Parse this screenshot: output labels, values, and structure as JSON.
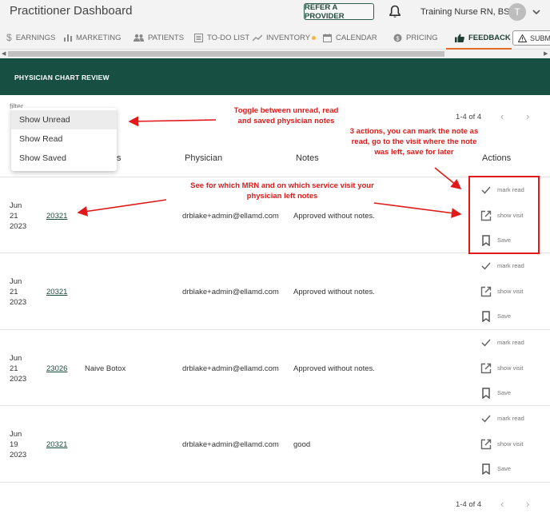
{
  "header": {
    "title": "Practitioner Dashboard",
    "refer_button": "REFER A PROVIDER",
    "user_name": "Training Nurse RN, BSN",
    "avatar_initial": "T"
  },
  "nav": {
    "earnings": "EARNINGS",
    "marketing": "MARKETING",
    "patients": "PATIENTS",
    "todo": "TO-DO LIST",
    "inventory": "INVENTORY",
    "calendar": "CALENDAR",
    "pricing": "PRICING",
    "feedback": "FEEDBACK",
    "submit": "SUBM",
    "active": "feedback",
    "accent_color": "#e36d24"
  },
  "section": {
    "title": "PHYSICIAN CHART REVIEW",
    "header_color": "#184f43"
  },
  "filter": {
    "label": "filter",
    "options": [
      "Show Unread",
      "Show Read",
      "Show Saved"
    ],
    "selected": "Show Unread"
  },
  "pagination": {
    "range_top": "1-4 of 4",
    "range_bottom": "1-4 of 4"
  },
  "table": {
    "columns": {
      "service": "s",
      "physician": "Physician",
      "notes": "Notes",
      "actions": "Actions"
    },
    "action_labels": {
      "mark_read": "mark read",
      "show_visit": "show visit",
      "save": "Save"
    },
    "rows": [
      {
        "month": "Jun",
        "day": "21",
        "year": "2023",
        "mrn": "20321",
        "service": "",
        "physician": "drblake+admin@ellamd.com",
        "notes": "Approved without notes."
      },
      {
        "month": "Jun",
        "day": "21",
        "year": "2023",
        "mrn": "20321",
        "service": "",
        "physician": "drblake+admin@ellamd.com",
        "notes": "Approved without notes."
      },
      {
        "month": "Jun",
        "day": "21",
        "year": "2023",
        "mrn": "23026",
        "service": "Naive Botox",
        "physician": "drblake+admin@ellamd.com",
        "notes": "Approved without notes."
      },
      {
        "month": "Jun",
        "day": "19",
        "year": "2023",
        "mrn": "20321",
        "service": "",
        "physician": "drblake+admin@ellamd.com",
        "notes": "good"
      }
    ]
  },
  "annotations": {
    "toggle_line1": "Toggle between unread, read",
    "toggle_line2": "and saved physician notes",
    "actions_line1": "3 actions, you can mark the note as",
    "actions_line2": "read, go to the visit where the note",
    "actions_line3": "was left, save for later",
    "mrn_line1": "See for which MRN and on which service visit your",
    "mrn_line2": "physician left notes",
    "color": "#e01a1a"
  }
}
